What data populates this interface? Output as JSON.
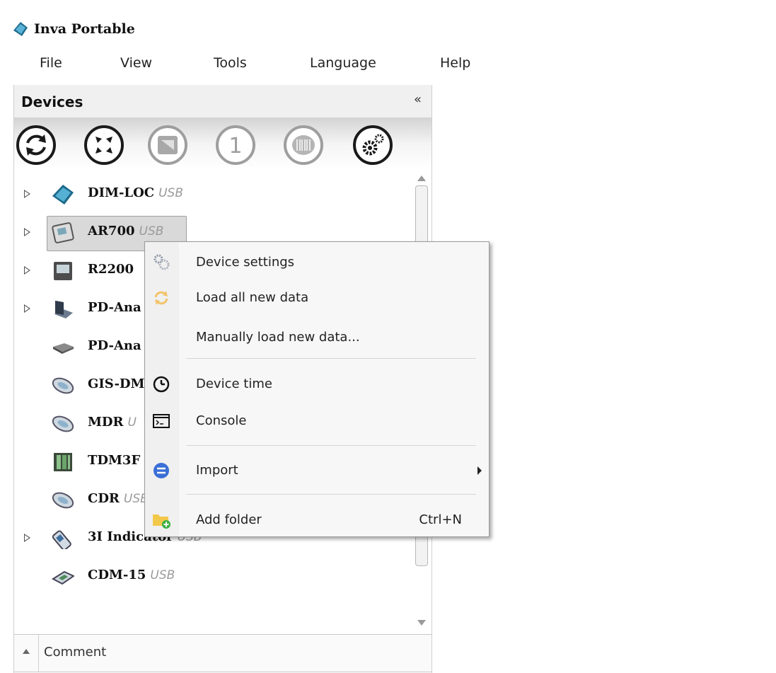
{
  "window": {
    "title": "Inva Portable",
    "app_icon": "inva-logo-icon"
  },
  "menubar": [
    {
      "label": "File"
    },
    {
      "label": "View"
    },
    {
      "label": "Tools"
    },
    {
      "label": "Language"
    },
    {
      "label": "Help"
    }
  ],
  "devices_panel": {
    "title": "Devices",
    "collapse_label": "«",
    "toolbar": [
      {
        "icon": "refresh-icon"
      },
      {
        "icon": "compress-icon"
      },
      {
        "icon": "recorder-icon"
      },
      {
        "icon": "number-one-icon"
      },
      {
        "icon": "barcode-icon"
      },
      {
        "icon": "settings-gears-icon"
      }
    ]
  },
  "devices": [
    {
      "name": "DIM-LOC",
      "connection": "USB",
      "expandable": true,
      "icon": "dim-loc-device-icon"
    },
    {
      "name": "AR700",
      "connection": "USB",
      "expandable": true,
      "selected": true,
      "icon": "ar700-device-icon"
    },
    {
      "name": "R2200",
      "connection": "",
      "expandable": true,
      "icon": "r2200-device-icon"
    },
    {
      "name": "PD-Ana",
      "connection": "",
      "expandable": true,
      "icon": "pd-analyzer-laptop-icon"
    },
    {
      "name": "PD-Ana",
      "connection": "",
      "expandable": false,
      "icon": "pd-analyzer-box-icon"
    },
    {
      "name": "GIS-DM",
      "connection": "",
      "expandable": false,
      "icon": "gis-dm-device-icon"
    },
    {
      "name": "MDR",
      "connection": "U",
      "expandable": false,
      "icon": "mdr-device-icon"
    },
    {
      "name": "TDM3F",
      "connection": "",
      "expandable": false,
      "icon": "tdm3f-device-icon"
    },
    {
      "name": "CDR",
      "connection": "USB",
      "expandable": false,
      "icon": "cdr-device-icon"
    },
    {
      "name": "3I Indicator",
      "connection": "USB",
      "expandable": true,
      "icon": "3i-indicator-device-icon"
    },
    {
      "name": "CDM-15",
      "connection": "USB",
      "expandable": false,
      "icon": "cdm-15-device-icon"
    }
  ],
  "comment_bar": {
    "label": "Comment"
  },
  "context_menu": {
    "items": [
      {
        "label": "Device settings",
        "icon": "gears-icon"
      },
      {
        "label": "Load all new data",
        "icon": "refresh-orange-icon"
      },
      {
        "label": "Manually load new data...",
        "icon": ""
      },
      {
        "label": "Device time",
        "icon": "clock-icon"
      },
      {
        "label": "Console",
        "icon": "console-icon"
      },
      {
        "label": "Import",
        "icon": "import-icon",
        "submenu": true
      },
      {
        "label": "Add folder",
        "icon": "add-folder-icon",
        "shortcut": "Ctrl+N"
      }
    ]
  },
  "colors": {
    "usb_text": "#9a9a9a",
    "selection_bg": "#d9d9d9",
    "menu_bg": "#f7f7f7",
    "folder_yellow": "#f2c84b",
    "add_green": "#3cb043"
  }
}
